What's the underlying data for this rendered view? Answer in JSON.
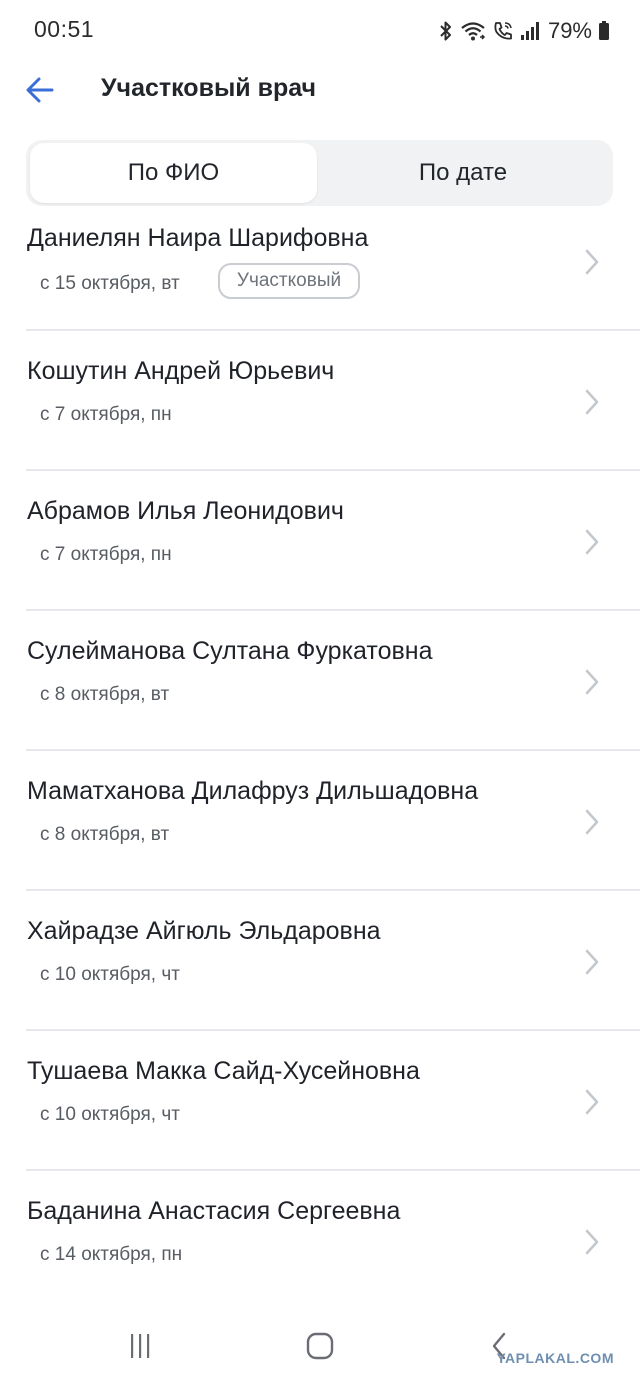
{
  "status_bar": {
    "time": "00:51",
    "battery": "79%",
    "icons": [
      "bluetooth-icon",
      "wifi-icon",
      "wifi-call-icon",
      "signal-icon",
      "battery-icon"
    ]
  },
  "header": {
    "title": "Участковый врач",
    "back_icon": "arrow-left-icon"
  },
  "tabs": [
    {
      "label": "По ФИО",
      "active": true
    },
    {
      "label": "По дате",
      "active": false
    }
  ],
  "doctors": [
    {
      "name": "Даниелян Наира Шарифовна",
      "date": "с 15 октября, вт",
      "badge": "Участковый"
    },
    {
      "name": "Кошутин Андрей Юрьевич",
      "date": "с 7 октября, пн"
    },
    {
      "name": "Абрамов Илья Леонидович",
      "date": "с 7 октября, пн"
    },
    {
      "name": "Сулейманова Султана Фуркатовна",
      "date": "с 8 октября, вт"
    },
    {
      "name": "Маматханова Дилафруз Дильшадовна",
      "date": "с 8 октября, вт"
    },
    {
      "name": "Хайрадзе Айгюль Эльдаровна",
      "date": "с 10 октября, чт"
    },
    {
      "name": "Тушаева Макка Сайд-Хусейновна",
      "date": "с 10 октября, чт"
    },
    {
      "name": "Баданина Анастасия Сергеевна",
      "date": "с 14 октября, пн"
    }
  ],
  "nav_bar": {
    "icons": [
      "recent-apps-icon",
      "home-icon",
      "back-icon"
    ]
  },
  "watermark": "YAPLAKAL.COM",
  "colors": {
    "accent": "#3b6fd8",
    "divider": "#e6e8eb",
    "segment_bg": "#f1f2f4",
    "text_secondary": "#585d63"
  }
}
